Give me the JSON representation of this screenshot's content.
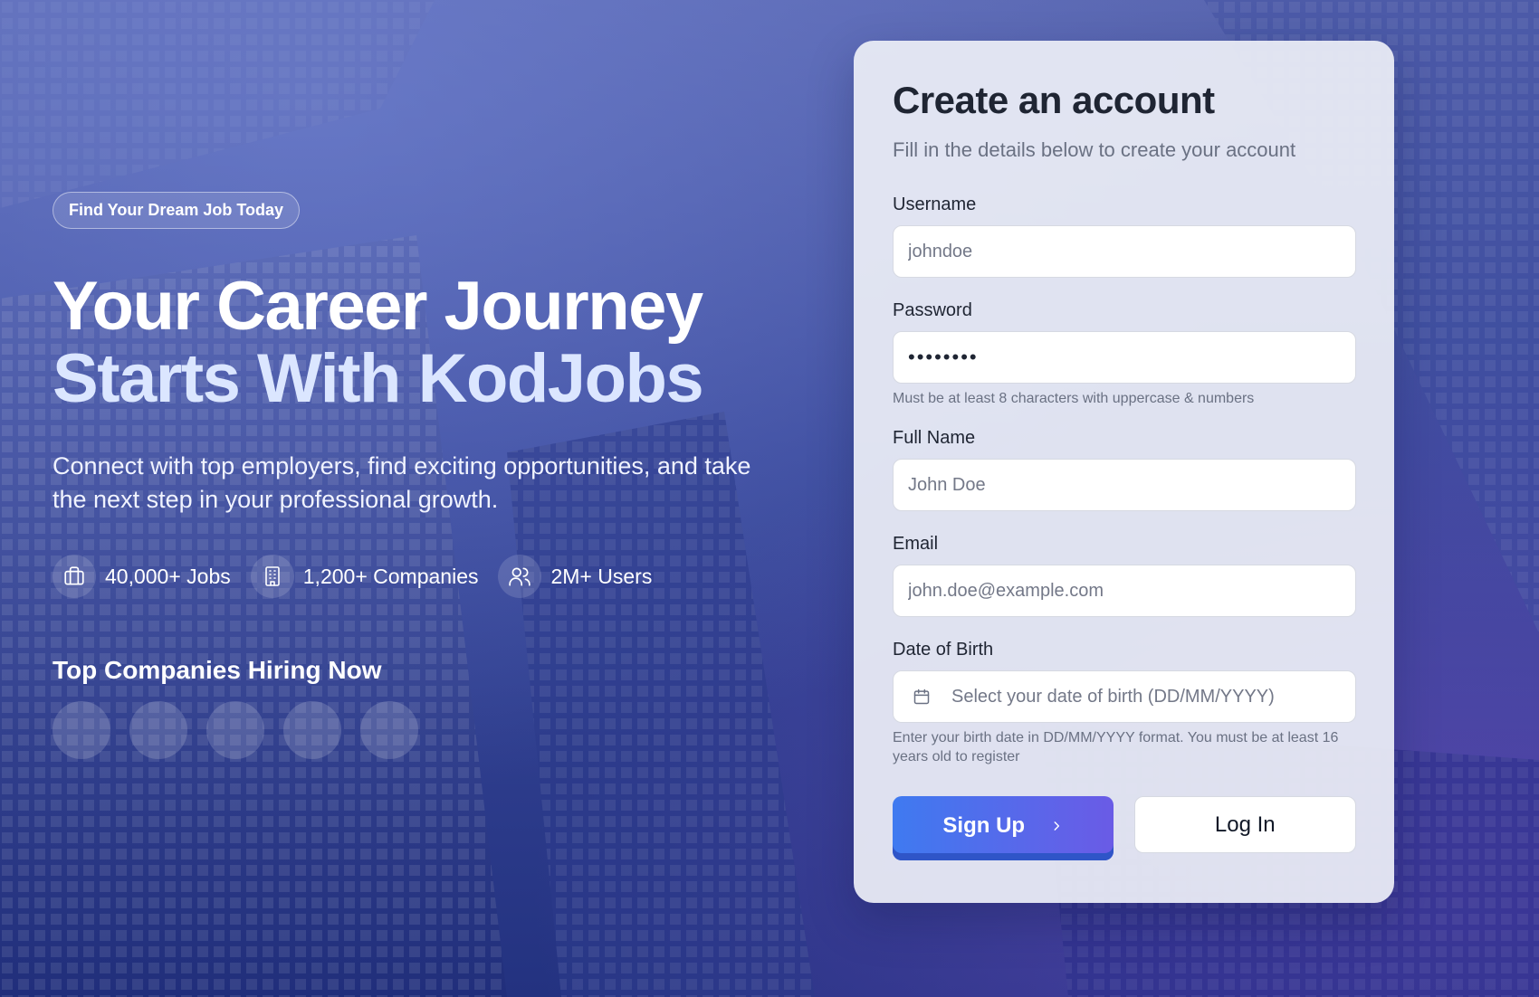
{
  "hero": {
    "badge": "Find Your Dream Job Today",
    "headline_line1": "Your Career Journey",
    "headline_line2": "Starts With KodJobs",
    "subtitle": "Connect with top employers, find exciting opportunities, and take the next step in your professional growth.",
    "stats": [
      {
        "icon": "briefcase-icon",
        "label": "40,000+ Jobs"
      },
      {
        "icon": "building-icon",
        "label": "1,200+ Companies"
      },
      {
        "icon": "users-icon",
        "label": "2M+ Users"
      }
    ],
    "companies_title": "Top Companies Hiring Now"
  },
  "form": {
    "title": "Create an account",
    "subtitle": "Fill in the details below to create your account",
    "username": {
      "label": "Username",
      "placeholder": "johndoe",
      "value": ""
    },
    "password": {
      "label": "Password",
      "value": "••••••••",
      "hint": "Must be at least 8 characters with uppercase & numbers"
    },
    "full_name": {
      "label": "Full Name",
      "placeholder": "John Doe",
      "value": ""
    },
    "email": {
      "label": "Email",
      "placeholder": "john.doe@example.com",
      "value": ""
    },
    "dob": {
      "label": "Date of Birth",
      "placeholder": "Select your date of birth (DD/MM/YYYY)",
      "icon": "calendar-icon",
      "hint": "Enter your birth date in DD/MM/YYYY format. You must be at least 16 years old to register"
    },
    "signup_label": "Sign Up",
    "login_label": "Log In"
  },
  "colors": {
    "accent_start": "#3f7af0",
    "accent_end": "#6a5be6",
    "background": "#3b4a9c"
  }
}
